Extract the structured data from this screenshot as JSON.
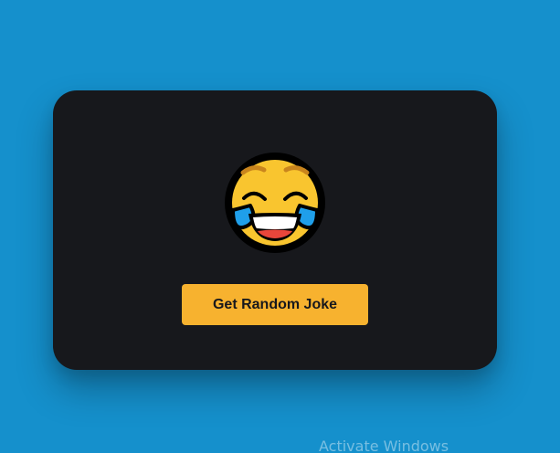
{
  "card": {
    "emoji_icon": "face-with-tears-of-joy-icon",
    "button_label": "Get Random Joke"
  },
  "watermark": {
    "text": "Activate Windows"
  },
  "colors": {
    "background": "#1590cc",
    "card": "#17181c",
    "button": "#f7b22f",
    "button_text": "#17181c"
  }
}
